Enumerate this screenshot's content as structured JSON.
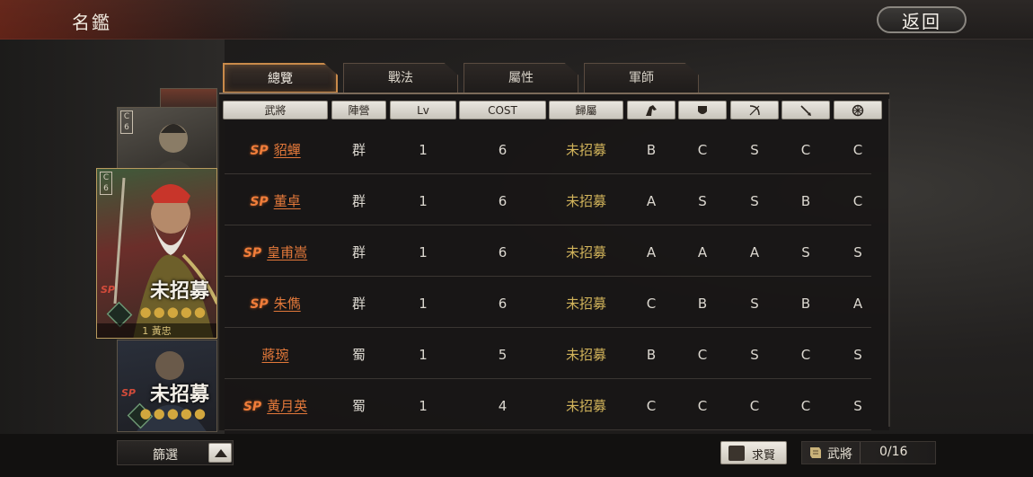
{
  "header": {
    "title": "名鑑",
    "back_label": "返回"
  },
  "tabs": [
    {
      "label": "總覽",
      "active": true
    },
    {
      "label": "戰法",
      "active": false
    },
    {
      "label": "屬性",
      "active": false
    },
    {
      "label": "軍師",
      "active": false
    }
  ],
  "columns": [
    {
      "label": "武將"
    },
    {
      "label": "陣營"
    },
    {
      "label": "Lv"
    },
    {
      "label": "COST"
    },
    {
      "label": "歸屬"
    },
    {
      "icon": "cavalry-icon"
    },
    {
      "icon": "shield-icon"
    },
    {
      "icon": "bow-icon"
    },
    {
      "icon": "spear-icon"
    },
    {
      "icon": "siege-icon"
    }
  ],
  "rows": [
    {
      "sp": "SP",
      "name": "貂蟬",
      "faction": "群",
      "lv": "1",
      "cost": "6",
      "status": "未招募",
      "aptitudes": [
        "B",
        "C",
        "S",
        "C",
        "C"
      ]
    },
    {
      "sp": "SP",
      "name": "董卓",
      "faction": "群",
      "lv": "1",
      "cost": "6",
      "status": "未招募",
      "aptitudes": [
        "A",
        "S",
        "S",
        "B",
        "C"
      ]
    },
    {
      "sp": "SP",
      "name": "皇甫嵩",
      "faction": "群",
      "lv": "1",
      "cost": "6",
      "status": "未招募",
      "aptitudes": [
        "A",
        "A",
        "A",
        "S",
        "S"
      ]
    },
    {
      "sp": "SP",
      "name": "朱儁",
      "faction": "群",
      "lv": "1",
      "cost": "6",
      "status": "未招募",
      "aptitudes": [
        "C",
        "B",
        "S",
        "B",
        "A"
      ]
    },
    {
      "sp": "",
      "name": "蔣琬",
      "faction": "蜀",
      "lv": "1",
      "cost": "5",
      "status": "未招募",
      "aptitudes": [
        "B",
        "C",
        "S",
        "C",
        "S"
      ]
    },
    {
      "sp": "SP",
      "name": "黃月英",
      "faction": "蜀",
      "lv": "1",
      "cost": "4",
      "status": "未招募",
      "aptitudes": [
        "C",
        "C",
        "C",
        "C",
        "S"
      ]
    }
  ],
  "cards": {
    "upper_badge": [
      "C",
      "6"
    ],
    "main_badge": [
      "C",
      "6"
    ],
    "main_status": "未招募",
    "main_sp": "SP",
    "main_stars": "●●●●●",
    "main_name": "1 黃忠",
    "lower_status": "未招募",
    "lower_sp": "SP",
    "lower_stars": "●●●●●"
  },
  "footer": {
    "filter_label": "篩選",
    "recruit_label": "求賢",
    "generals_label": "武將",
    "generals_count": "0/16"
  },
  "colors": {
    "accent": "#c98a4a",
    "name": "#e2783a",
    "status": "#d2b45b",
    "sp": "#f07d3a"
  }
}
